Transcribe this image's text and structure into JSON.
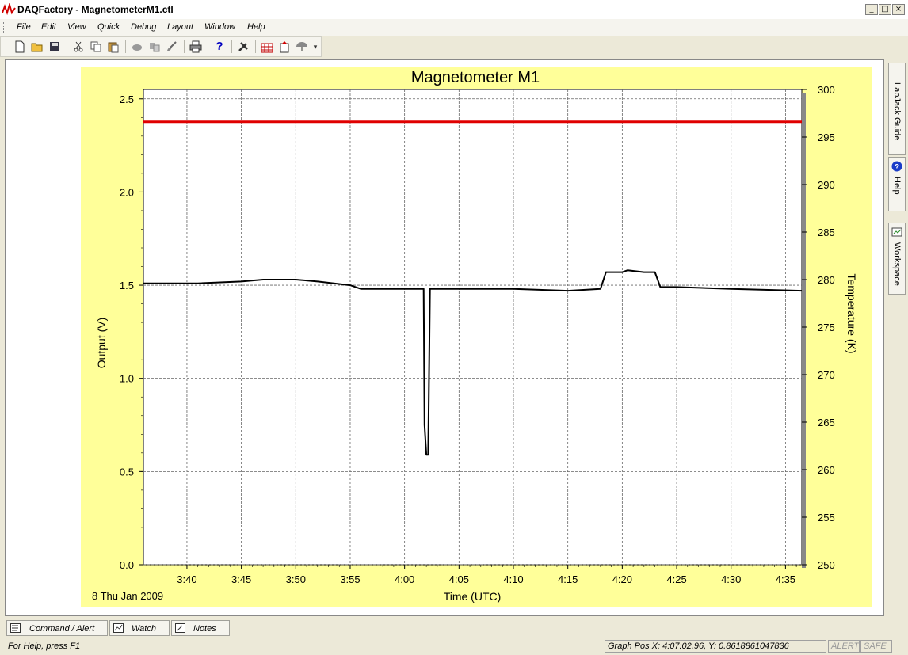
{
  "window": {
    "title": "DAQFactory - MagnetometerM1.ctl",
    "min_glyph": "_",
    "max_glyph": "□",
    "close_glyph": "×"
  },
  "menu": {
    "items": [
      "File",
      "Edit",
      "View",
      "Quick",
      "Debug",
      "Layout",
      "Window",
      "Help"
    ]
  },
  "toolbar": {
    "icons": [
      "new-file-icon",
      "open-folder-icon",
      "save-icon",
      "cut-icon",
      "copy-icon",
      "paste-icon",
      "link-icon",
      "duplicate-icon",
      "brush-icon",
      "print-icon",
      "help-question-icon",
      "tools-icon",
      "chart-icon",
      "export-icon",
      "umbrella-icon"
    ],
    "help_glyph": "?"
  },
  "side_tabs": [
    "LabJack Guide",
    "Help",
    "Workspace"
  ],
  "bottom_tabs": [
    "Command / Alert",
    "Watch",
    "Notes"
  ],
  "status": {
    "help_text": "For Help, press F1",
    "graph_pos": "Graph Pos X: 4:07:02.96, Y: 0.8618861047836",
    "alert": "ALERT",
    "safe": "SAFE"
  },
  "chart_data": {
    "type": "line",
    "title": "Magnetometer M1",
    "xlabel": "Time (UTC)",
    "ylabel": "Output (V)",
    "y2label": "Temperature (K)",
    "date_label": "8 Thu Jan 2009",
    "xlim": [
      "3:36",
      "4:36:30"
    ],
    "ylim": [
      0,
      2.55
    ],
    "y2lim": [
      250,
      300
    ],
    "x_ticks": [
      "3:40",
      "3:45",
      "3:50",
      "3:55",
      "4:00",
      "4:05",
      "4:10",
      "4:15",
      "4:20",
      "4:25",
      "4:30",
      "4:35"
    ],
    "y_ticks": [
      "0.0",
      "0.5",
      "1.0",
      "1.5",
      "2.0",
      "2.5"
    ],
    "y2_ticks": [
      "250",
      "255",
      "260",
      "265",
      "270",
      "275",
      "280",
      "285",
      "290",
      "295",
      "300"
    ],
    "grid": true,
    "colors": {
      "output": "#000000",
      "temperature": "#e00000",
      "panel": "#ffff99"
    },
    "series": [
      {
        "axis": "left",
        "x": [
          "3:36",
          "3:41",
          "3:45",
          "3:47",
          "3:50",
          "3:52",
          "3:55",
          "3:56",
          "4:00",
          "4:01",
          "4:01:45",
          "4:01:50",
          "4:02",
          "4:02:10",
          "4:02:20",
          "4:02:30",
          "4:03",
          "4:05",
          "4:10",
          "4:15",
          "4:18",
          "4:18:30",
          "4:20",
          "4:20:30",
          "4:22",
          "4:23",
          "4:23:30",
          "4:25",
          "4:30",
          "4:36:30"
        ],
        "values": [
          1.51,
          1.51,
          1.52,
          1.53,
          1.53,
          1.52,
          1.5,
          1.48,
          1.48,
          1.48,
          1.48,
          0.75,
          0.59,
          0.59,
          1.48,
          1.48,
          1.48,
          1.48,
          1.48,
          1.47,
          1.48,
          1.57,
          1.57,
          1.58,
          1.57,
          1.57,
          1.49,
          1.49,
          1.48,
          1.47
        ]
      },
      {
        "axis": "right",
        "x": [
          "3:36",
          "4:36:30"
        ],
        "values": [
          296.6,
          296.6
        ]
      }
    ]
  }
}
